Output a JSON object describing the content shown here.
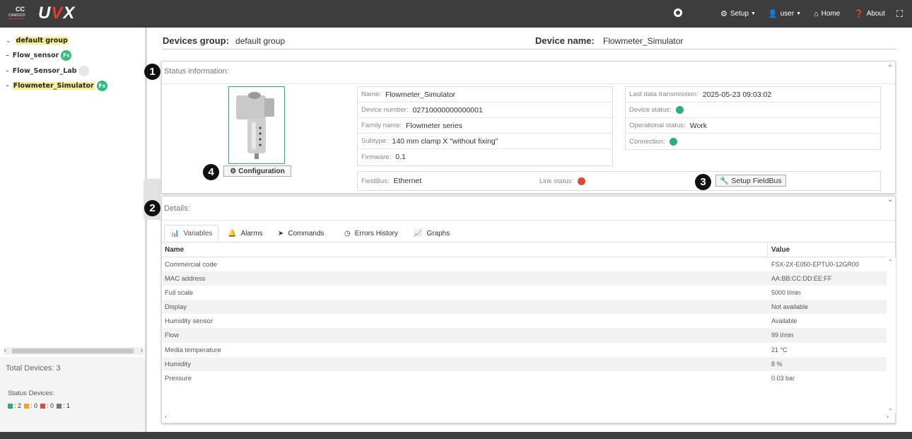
{
  "topbar": {
    "logo_small_mark": "CC",
    "logo_small_text": "CAMOZZI",
    "logo_text_a": "U",
    "logo_text_b": "V",
    "logo_text_c": "X",
    "setup_label": "Setup",
    "user_label": "user",
    "home_label": "Home",
    "about_label": "About"
  },
  "sidebar": {
    "group_label": "default group",
    "devices": [
      {
        "name": "Flow_sensor",
        "badge": "Fs",
        "selected": false,
        "badge_active": true
      },
      {
        "name": "Flow_Sensor_Lab",
        "badge": "",
        "selected": false,
        "badge_active": false
      },
      {
        "name": "Flowmeter_Simulator",
        "badge": "Fs",
        "selected": true,
        "badge_active": true
      }
    ],
    "total_devices": "Total Devices: 3",
    "status_title": "Status Devices:",
    "status_counts": [
      {
        "color": "#27b07a",
        "count": ": 2"
      },
      {
        "color": "#f0a020",
        "count": ": 0"
      },
      {
        "color": "#e04838",
        "count": ": 0"
      },
      {
        "color": "#777777",
        "count": ": 1"
      }
    ]
  },
  "header": {
    "group_label": "Devices group:",
    "group_value": "default group",
    "device_label": "Device name:",
    "device_value": "Flowmeter_Simulator"
  },
  "status_panel": {
    "title": "Status information:",
    "marker_1": "1",
    "marker_3": "3",
    "marker_4": "4",
    "configuration_button": "Configuration",
    "setup_fieldbus_button": "Setup FieldBus",
    "info": {
      "name_label": "Name:",
      "name_value": "Flowmeter_Simulator",
      "number_label": "Device number:",
      "number_value": "02710000000000001",
      "family_label": "Family name:",
      "family_value": "Flowmeter series",
      "subtype_label": "Subtype:",
      "subtype_value": "140 mm clamp X \"without fixing\"",
      "firmware_label": "Firmware:",
      "firmware_value": "0.1"
    },
    "state": {
      "last_tx_label": "Last data transmission:",
      "last_tx_value": "2025-05-23 09:03:02",
      "device_status_label": "Device status:",
      "operational_label": "Operational status:",
      "operational_value": "Work",
      "connection_label": "Connection:"
    },
    "fieldbus": {
      "label": "FieldBus:",
      "value": "Ethernet",
      "link_label": "Link status:"
    },
    "colors": {
      "ok": "#27b07a",
      "error": "#e04838"
    }
  },
  "details_panel": {
    "title": "Details:",
    "marker_2": "2",
    "tabs": [
      "Variables",
      "Alarms",
      "Commands",
      "Errors History",
      "Graphs"
    ],
    "columns": [
      "Name",
      "Value"
    ],
    "rows": [
      [
        "Commercial code",
        "FSX-2X-E050-EPTU0-12GR00"
      ],
      [
        "MAC address",
        "AA:BB:CC:DD:EE:FF"
      ],
      [
        "Full scale",
        "5000 l/min"
      ],
      [
        "Display",
        "Not available"
      ],
      [
        "Humidity sensor",
        "Available"
      ],
      [
        "Flow",
        "99 l/min"
      ],
      [
        "Media temperature",
        "21 °C"
      ],
      [
        "Humidity",
        "8 %"
      ],
      [
        "Pressure",
        "0.03 bar"
      ]
    ]
  }
}
